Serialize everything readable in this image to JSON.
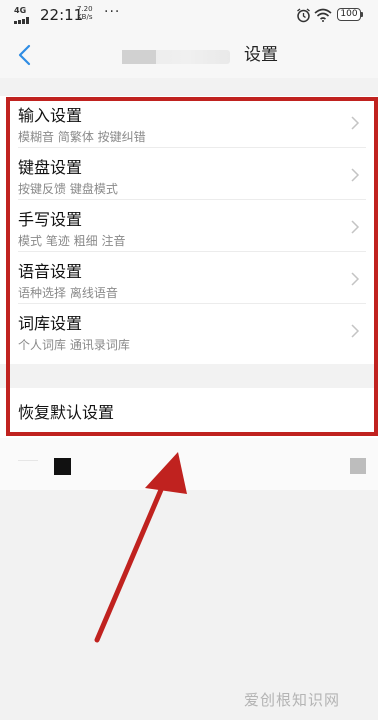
{
  "status_bar": {
    "network": "4G",
    "time": "22:11",
    "speed_value": "7.20",
    "speed_unit": "KB/s",
    "more": "···",
    "battery": "100"
  },
  "header": {
    "title_visible": "设置"
  },
  "settings": [
    {
      "label": "输入设置",
      "sub": "模糊音 简繁体 按键纠错"
    },
    {
      "label": "键盘设置",
      "sub": "按键反馈 键盘模式"
    },
    {
      "label": "手写设置",
      "sub": "模式 笔迹 粗细 注音"
    },
    {
      "label": "语音设置",
      "sub": "语种选择 离线语音"
    },
    {
      "label": "词库设置",
      "sub": "个人词库 通讯录词库"
    }
  ],
  "reset": {
    "label": "恢复默认设置"
  },
  "annotation": {
    "color": "#c0221f"
  },
  "watermark": {
    "text": "爱创根知识网"
  }
}
